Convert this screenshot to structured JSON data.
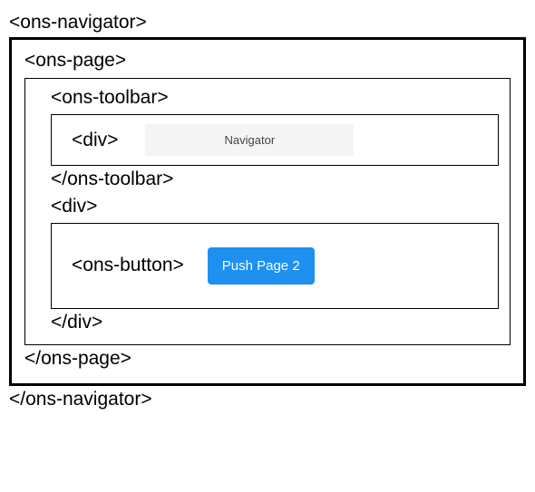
{
  "tags": {
    "navigator_open": "<ons-navigator>",
    "navigator_close": "</ons-navigator>",
    "page_open": "<ons-page>",
    "page_close": "</ons-page>",
    "toolbar_open": "<ons-toolbar>",
    "toolbar_close": "</ons-toolbar>",
    "div_open": "<div>",
    "div_close": "</div>",
    "button_tag": "<ons-button>"
  },
  "toolbar": {
    "title": "Navigator"
  },
  "content": {
    "button_label": "Push Page 2"
  }
}
